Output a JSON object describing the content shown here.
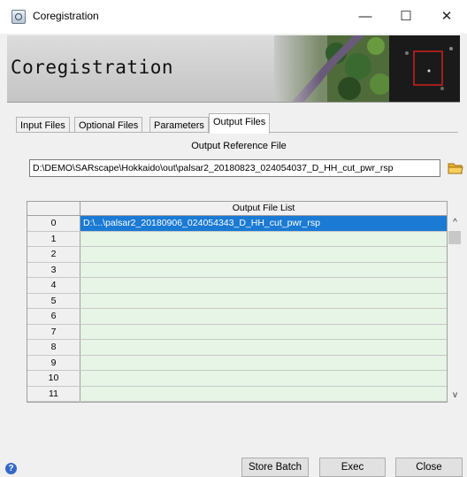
{
  "window": {
    "title": "Coregistration",
    "minimize_glyph": "—",
    "maximize_glyph": "☐",
    "close_glyph": "✕",
    "icon": "app-icon"
  },
  "banner": {
    "title": "Coregistration"
  },
  "tabs": [
    {
      "label": "Input Files",
      "active": false
    },
    {
      "label": "Optional Files",
      "active": false
    },
    {
      "label": "Parameters",
      "active": false
    },
    {
      "label": "Output Files",
      "active": true
    }
  ],
  "output_reference": {
    "label": "Output Reference File",
    "value": "D:\\DEMO\\SARscape\\Hokkaido\\out\\palsar2_20180823_024054037_D_HH_cut_pwr_rsp",
    "browse_icon": "folder-icon"
  },
  "output_list": {
    "header": "Output File List",
    "rows": [
      {
        "num": "0",
        "value": "D:\\...\\palsar2_20180906_024054343_D_HH_cut_pwr_rsp",
        "selected": true
      },
      {
        "num": "1",
        "value": ""
      },
      {
        "num": "2",
        "value": ""
      },
      {
        "num": "3",
        "value": ""
      },
      {
        "num": "4",
        "value": ""
      },
      {
        "num": "5",
        "value": ""
      },
      {
        "num": "6",
        "value": ""
      },
      {
        "num": "7",
        "value": ""
      },
      {
        "num": "8",
        "value": ""
      },
      {
        "num": "9",
        "value": ""
      },
      {
        "num": "10",
        "value": ""
      },
      {
        "num": "11",
        "value": ""
      }
    ]
  },
  "buttons": {
    "store_batch": "Store Batch",
    "exec": "Exec",
    "close": "Close"
  },
  "help_icon": "?",
  "colors": {
    "selection": "#1a7ad4",
    "cell_bg": "#e6f5e6"
  }
}
